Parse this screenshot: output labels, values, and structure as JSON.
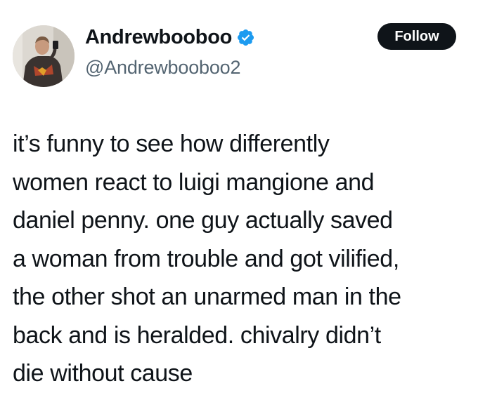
{
  "author": {
    "display_name": "Andrewbooboo",
    "handle": "@Andrewbooboo2",
    "verified": true,
    "avatar_icon": "profile-photo"
  },
  "actions": {
    "follow_label": "Follow"
  },
  "tweet": {
    "lines": [
      "it’s funny to see how differently",
      "women react to luigi mangione and",
      "daniel penny. one guy actually saved",
      "a woman from trouble and got vilified,",
      "the other shot an unarmed man in the",
      "back and is heralded. chivalry didn’t",
      "die without cause"
    ]
  },
  "colors": {
    "text": "#0f1419",
    "secondary": "#536471",
    "verified_blue": "#1d9bf0",
    "button_bg": "#0f1419",
    "button_text": "#ffffff"
  }
}
